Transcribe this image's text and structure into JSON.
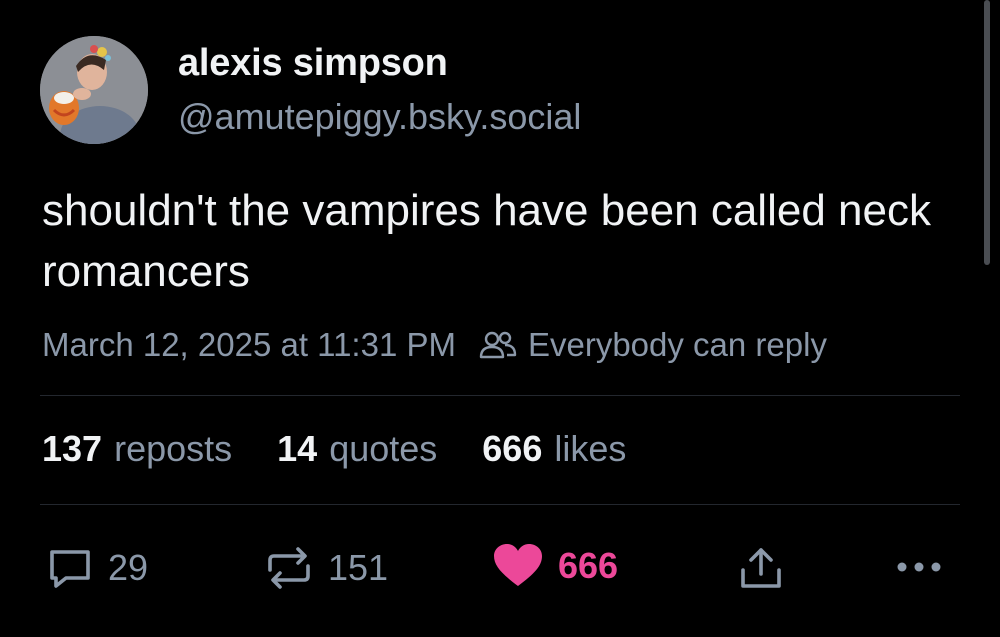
{
  "author": {
    "display_name": "alexis simpson",
    "handle": "@amutepiggy.bsky.social",
    "avatar_icon": "avatar-photo"
  },
  "post": {
    "text": "shouldn't the vampires have been called neck romancers",
    "timestamp": "March 12, 2025 at 11:31 PM",
    "reply_setting": "Everybody can reply"
  },
  "stats": {
    "reposts_count": "137",
    "reposts_label": "reposts",
    "quotes_count": "14",
    "quotes_label": "quotes",
    "likes_count": "666",
    "likes_label": "likes"
  },
  "actions": {
    "reply_count": "29",
    "repost_count": "151",
    "like_count": "666",
    "like_color": "#ec4899",
    "icons": [
      "speech-bubble-icon",
      "repost-icon",
      "heart-icon",
      "share-icon",
      "more-icon"
    ]
  },
  "colors": {
    "background": "#000000",
    "text_primary": "#f1f3f5",
    "text_secondary": "#8b98a9",
    "divider": "#23272e"
  }
}
